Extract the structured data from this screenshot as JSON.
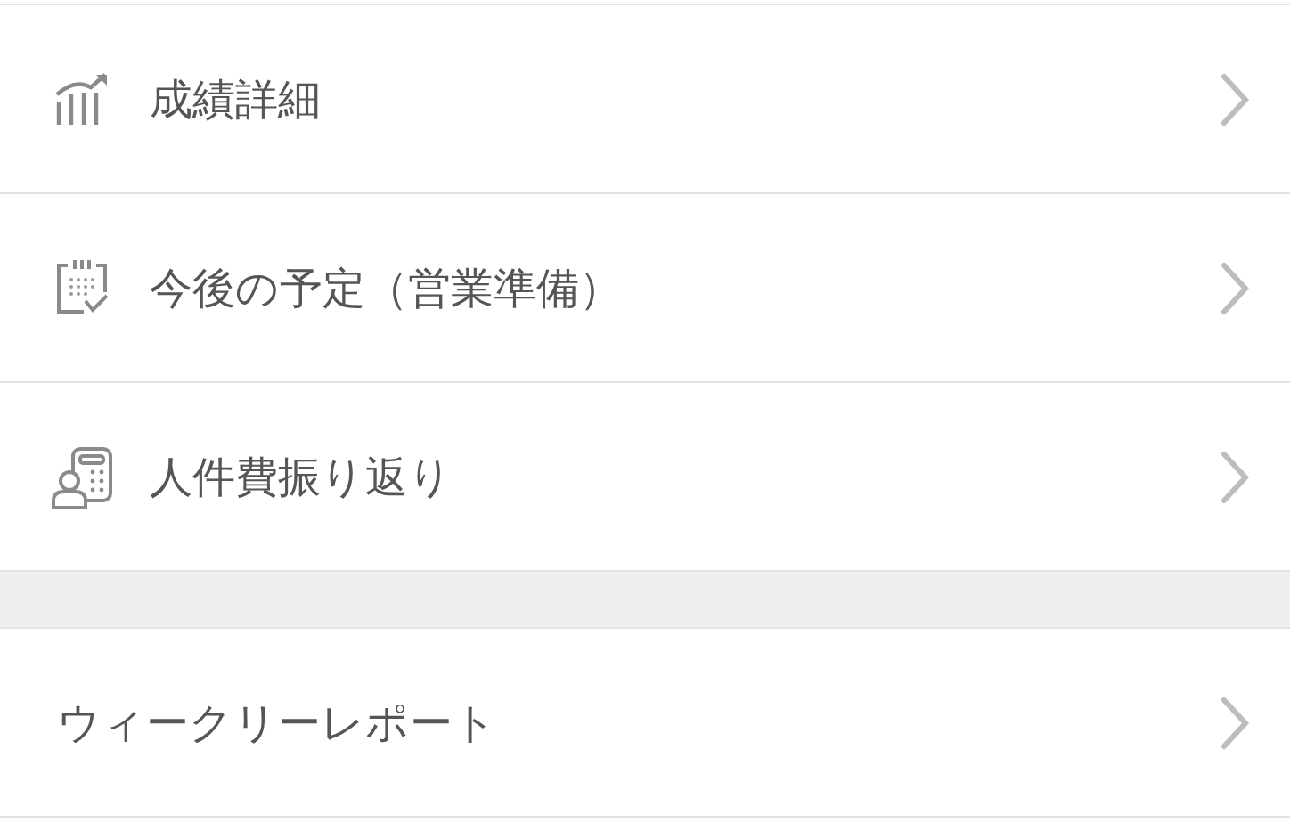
{
  "groups": [
    {
      "items": [
        {
          "label": "成績詳細",
          "kind": "chart"
        },
        {
          "label": "今後の予定（営業準備）",
          "kind": "calendar"
        },
        {
          "label": "人件費振り返り",
          "kind": "calculator"
        }
      ]
    },
    {
      "items": [
        {
          "label": "ウィークリーレポート",
          "kind": "plain"
        }
      ]
    }
  ]
}
